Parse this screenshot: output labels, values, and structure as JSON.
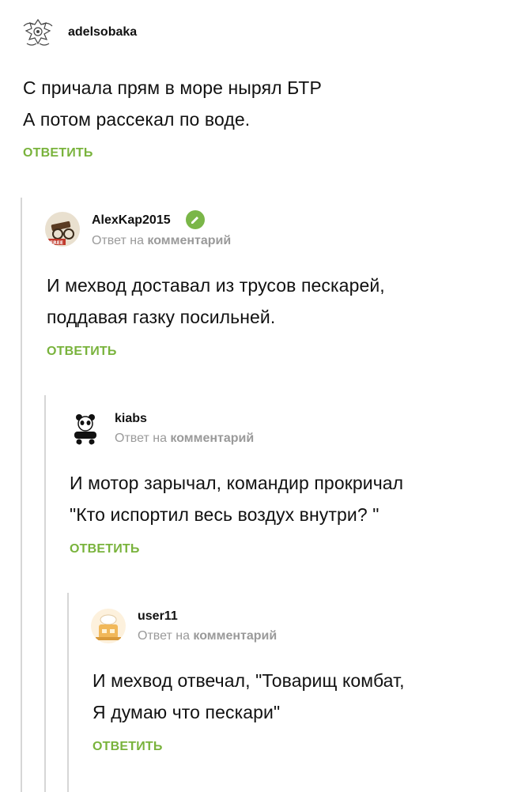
{
  "comments": [
    {
      "username": "adelsobaka",
      "lines": [
        "С причала прям в море нырял БТР",
        "А потом рассекал по воде."
      ],
      "reply_label": "ОТВЕТИТЬ"
    },
    {
      "username": "AlexKap2015",
      "verified": true,
      "reply_prefix": "Ответ на",
      "reply_target": "комментарий",
      "lines": [
        "И мехвод доставал из трусов пескарей,",
        "поддавая газку посильней."
      ],
      "reply_label": "ОТВЕТИТЬ"
    },
    {
      "username": "kiabs",
      "reply_prefix": "Ответ на",
      "reply_target": "комментарий",
      "lines": [
        "И мотор зарычал, командир прокричал",
        "\"Кто испортил весь воздух внутри? \""
      ],
      "reply_label": "ОТВЕТИТЬ"
    },
    {
      "username": "user11",
      "reply_prefix": "Ответ на",
      "reply_target": "комментарий",
      "lines": [
        "И мехвод отвечал, \"Товарищ комбат,",
        "Я думаю что пескари\""
      ],
      "reply_label": "ОТВЕТИТЬ"
    }
  ],
  "colors": {
    "accent": "#79b33c",
    "muted": "#9a9a9a",
    "thread_line": "#d6d6d6",
    "verified_badge": "#7ab648"
  },
  "icons": [
    "dragon-avatar-icon",
    "cannon-avatar-icon",
    "verified-pencil-icon",
    "panda-avatar-icon",
    "chef-avatar-icon"
  ]
}
